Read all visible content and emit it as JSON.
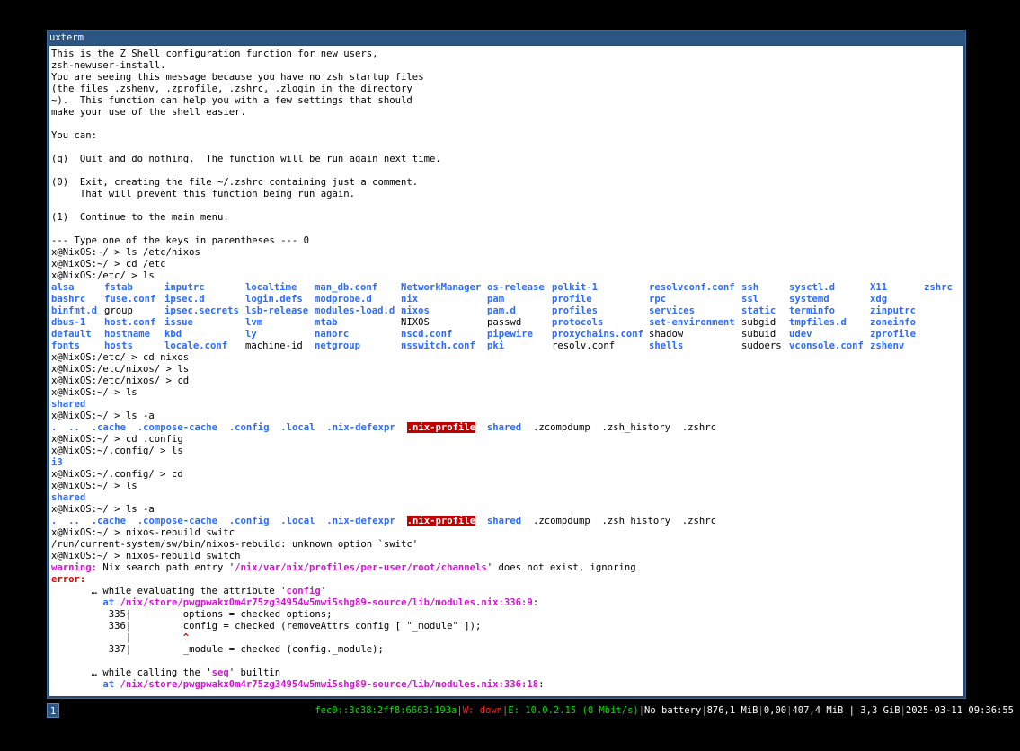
{
  "window": {
    "title": "uxterm"
  },
  "terminal": {
    "intro": [
      "This is the Z Shell configuration function for new users,",
      "zsh-newuser-install.",
      "You are seeing this message because you have no zsh startup files",
      "(the files .zshenv, .zprofile, .zshrc, .zlogin in the directory",
      "~).  This function can help you with a few settings that should",
      "make your use of the shell easier.",
      "",
      "You can:",
      "",
      "(q)  Quit and do nothing.  The function will be run again next time.",
      "",
      "(0)  Exit, creating the file ~/.zshrc containing just a comment.",
      "     That will prevent this function being run again.",
      "",
      "(1)  Continue to the main menu.",
      "",
      "--- Type one of the keys in parentheses --- 0",
      "x@NixOS:~/ > ls /etc/nixos",
      "x@NixOS:~/ > cd /etc",
      "x@NixOS:/etc/ > ls"
    ],
    "etc_listing": [
      [
        "alsa",
        "bashrc",
        "binfmt.d",
        "dbus-1",
        "default",
        "fonts"
      ],
      [
        "fstab",
        "fuse.conf",
        "group",
        "host.conf",
        "hostname",
        "hosts"
      ],
      [
        "inputrc",
        "ipsec.d",
        "ipsec.secrets",
        "issue",
        "kbd",
        "locale.conf"
      ],
      [
        "localtime",
        "login.defs",
        "lsb-release",
        "lvm",
        "ly",
        "machine-id"
      ],
      [
        "man_db.conf",
        "modprobe.d",
        "modules-load.d",
        "mtab",
        "nanorc",
        "netgroup"
      ],
      [
        "NetworkManager",
        "nix",
        "nixos",
        "NIXOS",
        "nscd.conf",
        "nsswitch.conf"
      ],
      [
        "os-release",
        "pam",
        "pam.d",
        "passwd",
        "pipewire",
        "pki"
      ],
      [
        "polkit-1",
        "profile",
        "profiles",
        "protocols",
        "proxychains.conf",
        "resolv.conf"
      ],
      [
        "resolvconf.conf",
        "rpc",
        "services",
        "set-environment",
        "shadow",
        "shells"
      ],
      [
        "ssh",
        "ssl",
        "static",
        "subgid",
        "subuid",
        "sudoers"
      ],
      [
        "sysctl.d",
        "systemd",
        "terminfo",
        "tmpfiles.d",
        "udev",
        "vconsole.conf"
      ],
      [
        "X11",
        "xdg",
        "zinputrc",
        "zoneinfo",
        "zprofile",
        "zshenv"
      ],
      [
        "zshrc",
        "",
        "",
        "",
        "",
        ""
      ]
    ],
    "after_ls": [
      "x@NixOS:/etc/ > cd nixos",
      "x@NixOS:/etc/nixos/ > ls",
      "x@NixOS:/etc/nixos/ > cd",
      "x@NixOS:~/ > ls"
    ],
    "shared_dir": "shared",
    "ls_a_cmd": "x@NixOS:~/ > ls -a",
    "dotfiles": [
      ".",
      "..",
      ".cache",
      ".compose-cache",
      ".config",
      ".local",
      ".nix-defexpr",
      ".nix-profile",
      "shared",
      ".zcompdump",
      ".zsh_history",
      ".zshrc"
    ],
    "config_cmds": [
      "x@NixOS:~/ > cd .config",
      "x@NixOS:~/.config/ > ls"
    ],
    "i3_dir": "i3",
    "back_cmds": [
      "x@NixOS:~/.config/ > cd",
      "x@NixOS:~/ > ls"
    ],
    "rebuild_cmd1": "x@NixOS:~/ > nixos-rebuild switc",
    "rebuild_err": "/run/current-system/sw/bin/nixos-rebuild: unknown option `switc'",
    "rebuild_cmd2": "x@NixOS:~/ > nixos-rebuild switch",
    "warning_label": "warning:",
    "warning_pre": " Nix search path entry '",
    "warning_path": "/nix/var/nix/profiles/per-user/root/channels",
    "warning_post": "' does not exist, ignoring",
    "error_label": "error:",
    "trace1_pre": "       … while evaluating the attribute '",
    "trace1_attr": "config",
    "trace1_post": "'",
    "at_label": "         at ",
    "at_path1": "/nix/store/pwgpwakx0m4r75zg34954w5mwi5shg89-source/lib/modules.nix:336:9",
    "colon": ":",
    "code_335": "          335|         options = checked options;",
    "code_336": "          336|         config = checked (removeAttrs config [ \"_module\" ]);",
    "code_mark_pre": "             |         ",
    "code_mark": "^",
    "code_337": "          337|         _module = checked (config._module);",
    "trace2_pre": "       … while calling the '",
    "trace2_attr": "seq",
    "trace2_post": "' builtin",
    "at_path2": "/nix/store/pwgpwakx0m4r75zg34954w5mwi5shg89-source/lib/modules.nix:336:18"
  },
  "statusbar": {
    "workspace": "1",
    "ipv6": "fec0::3c38:2ff8:6663:193a",
    "wifi": "W: down",
    "ethernet": "E: 10.0.2.15 (0 Mbit/s)",
    "battery": "No battery",
    "memory_used": "876,1 MiB",
    "load": "0,00",
    "disk": "407,4 MiB | 3,3 GiB",
    "datetime": "2025-03-11 09:36:55"
  },
  "colors": {
    "dir": "#2b6bff",
    "highlight_bg": "#c00000",
    "path": "#d414d4",
    "error": "#e00000",
    "status_ok": "#00e000",
    "status_bad": "#ff2020"
  }
}
